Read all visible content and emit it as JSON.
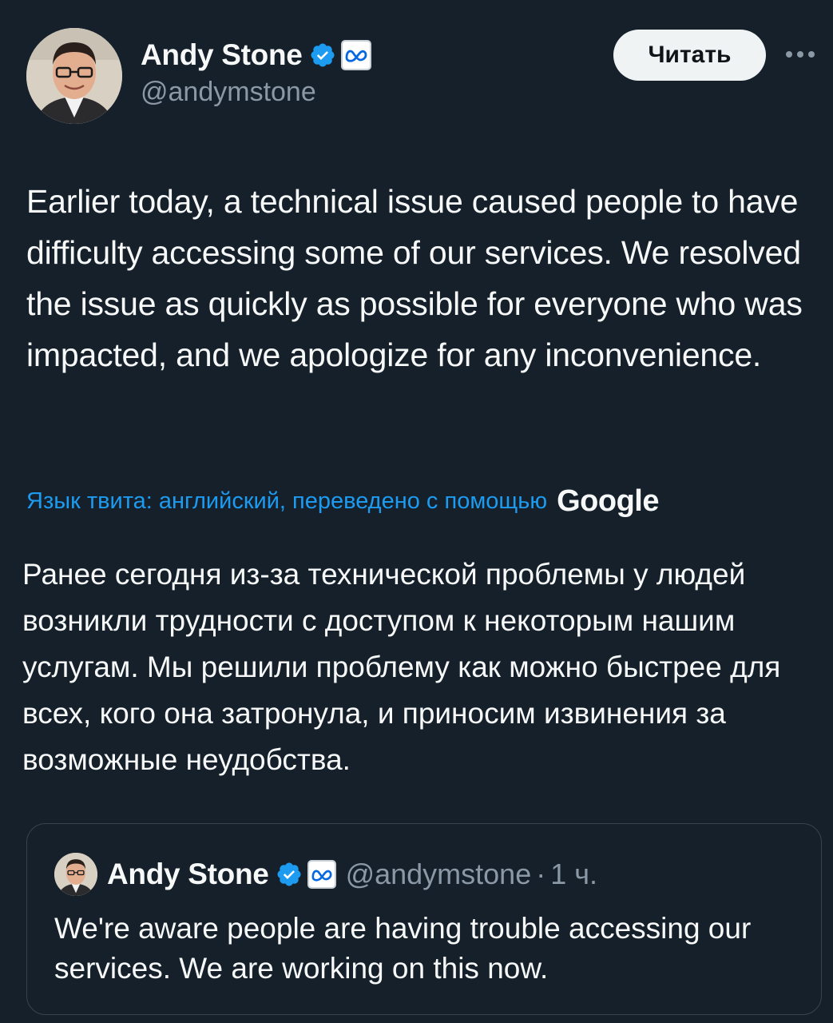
{
  "author": {
    "display_name": "Andy Stone",
    "handle": "@andymstone",
    "verified_icon": "verified-badge-icon",
    "affiliation_icon": "meta-logo-icon"
  },
  "follow_button": {
    "label": "Читать"
  },
  "more_icon": "more-options-icon",
  "tweet": {
    "text": "Earlier today, a technical issue caused people to have difficulty accessing some of our services. We resolved the issue as quickly as possible for everyone who was impacted, and we apologize for any inconvenience."
  },
  "translation": {
    "link_text": "Язык твита: английский, переведено с помощью",
    "provider": "Google",
    "text": "Ранее сегодня из-за технической проблемы у людей возникли трудности с доступом к некоторым нашим услугам. Мы решили проблему как можно быстрее для всех, кого она затронула, и приносим извинения за возможные неудобства."
  },
  "quoted_tweet": {
    "display_name": "Andy Stone",
    "handle": "@andymstone",
    "separator": "·",
    "time": "1 ч.",
    "text": "We're aware people are having trouble accessing our services. We are working on this now."
  },
  "colors": {
    "background": "#15202b",
    "text": "#f7f9f9",
    "secondary": "#8b98a5",
    "accent": "#1d9bf0",
    "border": "#38444d"
  }
}
